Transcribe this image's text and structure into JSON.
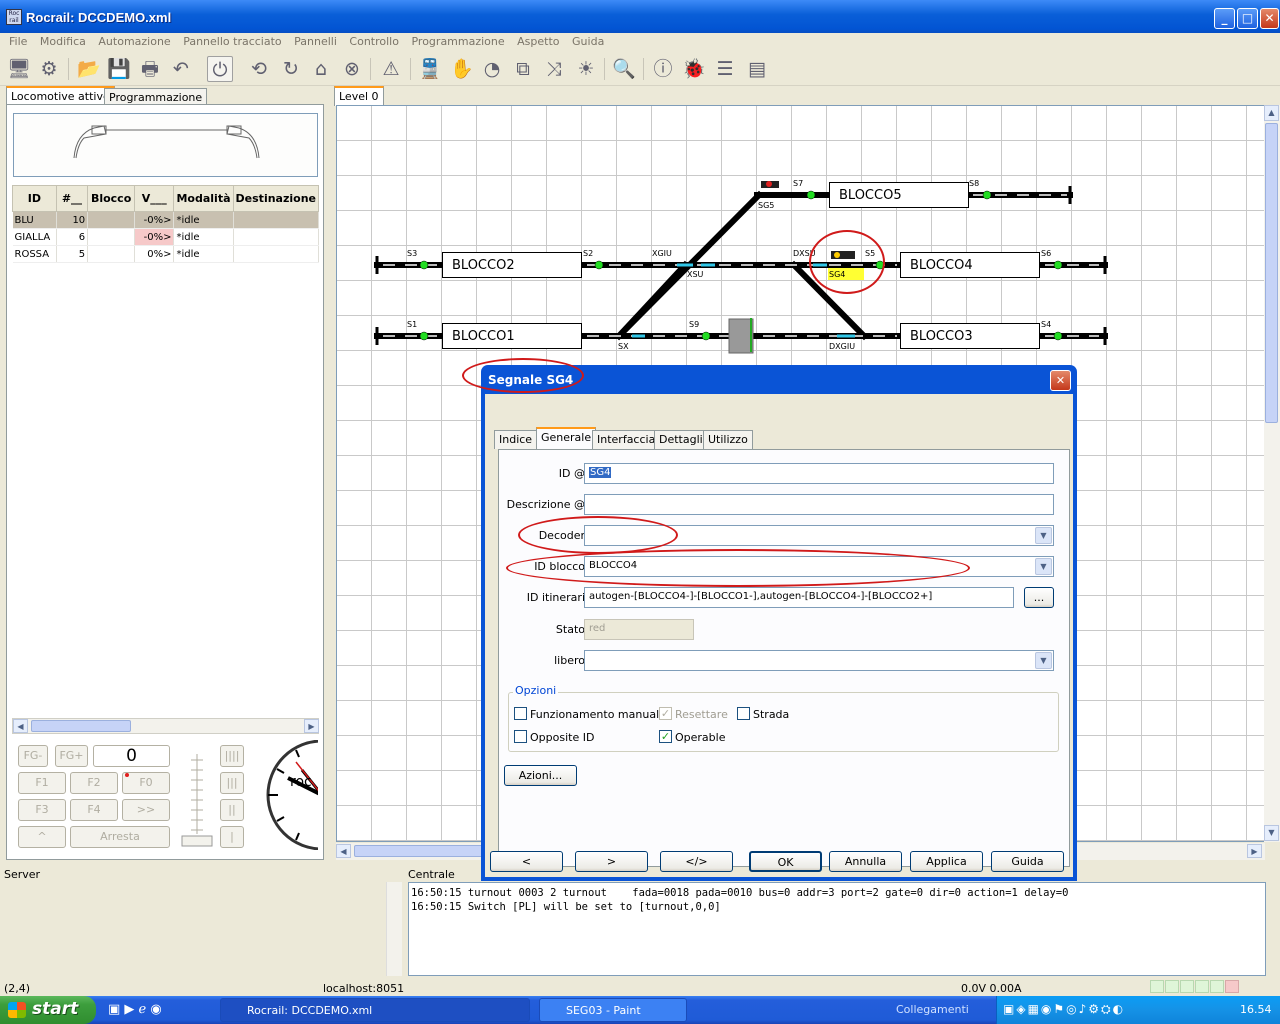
{
  "window": {
    "title": "Rocrail: DCCDEMO.xml"
  },
  "menu": [
    "File",
    "Modifica",
    "Automazione",
    "Pannello tracciato",
    "Pannelli",
    "Controllo",
    "Programmazione",
    "Aspetto",
    "Guida"
  ],
  "left_tabs": [
    "Locomotive attive",
    "Programmazione"
  ],
  "loco_table": {
    "headers": [
      "ID",
      "#__",
      "Blocco",
      "V___",
      "Modalità",
      "Destinazione"
    ],
    "rows": [
      {
        "id": "BLU",
        "num": "10",
        "blocco": "",
        "v": "-0%>",
        "mode": "*idle",
        "dest": ""
      },
      {
        "id": "GIALLA",
        "num": "6",
        "blocco": "",
        "v": "-0%>",
        "mode": "*idle",
        "dest": ""
      },
      {
        "id": "ROSSA",
        "num": "5",
        "blocco": "",
        "v": "0%>",
        "mode": "*idle",
        "dest": ""
      }
    ]
  },
  "loco_controls": {
    "fg_minus": "FG-",
    "fg_plus": "FG+",
    "speed": "0",
    "f1": "F1",
    "f2": "F2",
    "f0": "F0",
    "f3": "F3",
    "f4": "F4",
    "more": ">>",
    "up": "^",
    "stop": "Arresta"
  },
  "level_tab": "Level 0",
  "layout": {
    "blocks": [
      "BLOCCO5",
      "BLOCCO2",
      "BLOCCO4",
      "BLOCCO1",
      "BLOCCO3"
    ],
    "labels": {
      "s7": "S7",
      "sg5": "SG5",
      "s8": "S8",
      "s3": "S3",
      "s2": "S2",
      "xgiu": "XGIU",
      "xsu": "XSU",
      "dxsu": "DXSU",
      "s5": "S5",
      "sg4": "SG4",
      "s6": "S6",
      "s1": "S1",
      "s9": "S9",
      "sx": "SX",
      "dxgiu": "DXGIU",
      "s4": "S4"
    }
  },
  "dialog": {
    "title": "Segnale SG4",
    "tabs": [
      "Indice",
      "Generale",
      "Interfaccia",
      "Dettagli",
      "Utilizzo"
    ],
    "fields": {
      "id_label": "ID @",
      "id_value": "SG4",
      "desc_label": "Descrizione @",
      "desc_value": "",
      "decoder_label": "Decoder",
      "decoder_value": "",
      "block_label": "ID blocco",
      "block_value": "BLOCCO4",
      "routes_label": "ID itinerari",
      "routes_value": "autogen-[BLOCCO4-]-[BLOCCO1-],autogen-[BLOCCO4-]-[BLOCCO2+]",
      "routes_btn": "...",
      "state_label": "Stato",
      "state_value": "red",
      "free_label": "libero",
      "free_value": ""
    },
    "options": {
      "group_label": "Opzioni",
      "manual": "Funzionamento manuale",
      "manual_checked": false,
      "reset": "Resettare",
      "reset_checked": true,
      "road": "Strada",
      "road_checked": false,
      "opposite": "Opposite ID",
      "opposite_checked": false,
      "operable": "Operable",
      "operable_checked": true
    },
    "actions_btn": "Azioni...",
    "buttons": {
      "prev": "<",
      "next": ">",
      "xml": "</>",
      "ok": "OK",
      "cancel": "Annulla",
      "apply": "Applica",
      "help": "Guida"
    }
  },
  "panels": {
    "server": "Server",
    "central": "Centrale"
  },
  "console_lines": [
    "16:50:15 turnout 0003 2 turnout    fada=0018 pada=0010 bus=0 addr=3 port=2 gate=0 dir=0 action=1 delay=0",
    "16:50:15 Switch [PL] will be set to [turnout,0,0]"
  ],
  "status": {
    "coords": "(2,4)",
    "host": "localhost:8051",
    "power": "0.0V 0.00A"
  },
  "taskbar": {
    "start": "start",
    "tasks": [
      "Rocrail: DCCDEMO.xml",
      "SEG03 - Paint"
    ],
    "links": "Collegamenti",
    "clock": "16.54"
  },
  "colors": {
    "signal_red_ellipse": "#d01a1a",
    "accent_tab": "#ff9a1a",
    "track_active": "#31c7e8",
    "signal_green": "#22dd22"
  }
}
